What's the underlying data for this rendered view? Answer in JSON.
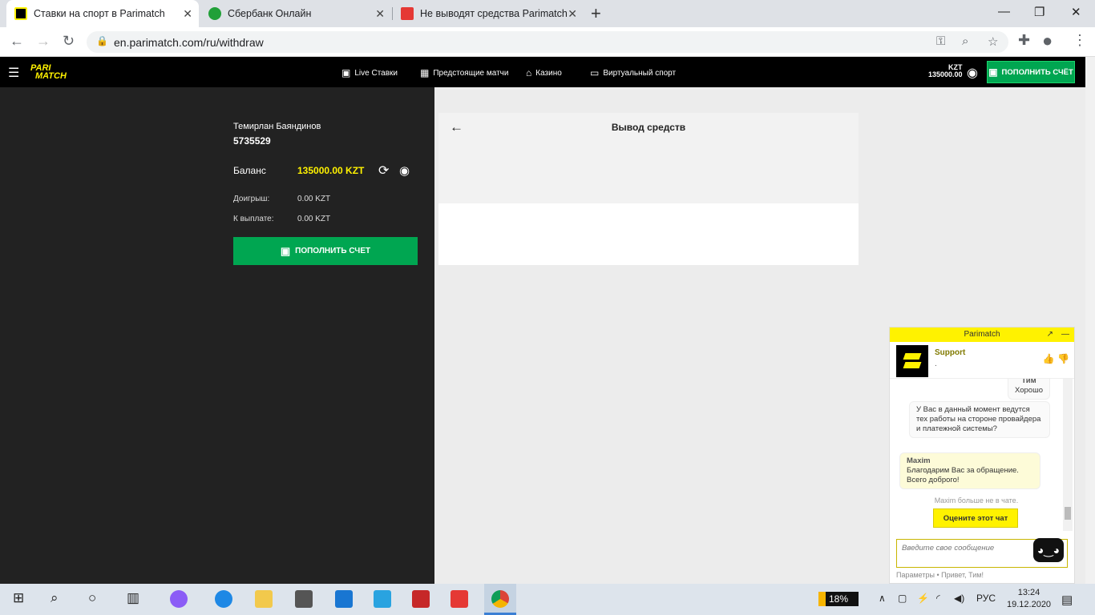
{
  "browser": {
    "tabs": [
      {
        "title": "Ставки на спорт в Parimatch",
        "active": true
      },
      {
        "title": "Сбербанк Онлайн",
        "active": false
      },
      {
        "title": "Не выводят средства Parimatch",
        "active": false
      }
    ],
    "url": "en.parimatch.com/ru/withdraw",
    "new_tab": "+",
    "close": "✕"
  },
  "header": {
    "logo_top": "PARI",
    "logo_bottom": "MATCH",
    "nav": [
      {
        "label": "Live Ставки",
        "icon": "live-icon"
      },
      {
        "label": "Предстоящие матчи",
        "icon": "calendar-icon"
      },
      {
        "label": "Казино",
        "icon": "casino-icon"
      },
      {
        "label": "Виртуальный спорт",
        "icon": "virtual-icon"
      }
    ],
    "currency": "KZT",
    "balance": "135000.00",
    "deposit_label": "ПОПОЛНИТЬ СЧЁТ"
  },
  "account": {
    "name": "Темирлан Баяндинов",
    "id": "5735529",
    "balance_label": "Баланс",
    "balance_value": "135000.00 KZT",
    "wager_label": "Доигрыш:",
    "wager_value": "0.00 KZT",
    "payout_label": "К выплате:",
    "payout_value": "0.00 KZT",
    "deposit_label": "ПОПОЛНИТЬ СЧЕТ"
  },
  "withdraw": {
    "title": "Вывод средств"
  },
  "chat": {
    "brand": "Parimatch",
    "agent": "Support",
    "agent_status": ".",
    "messages": {
      "m1_name": "Тим",
      "m1_text": "Хорошо",
      "m2_text": "У Вас в данный момент ведутся тех работы на стороне провайдера и платежной системы?",
      "m3_name": "Maxim",
      "m3_text": "Благодарим Вас за обращение. Всего доброго!"
    },
    "system": "Maxim больше не в чате.",
    "rate_label": "Оцените этот чат",
    "input_placeholder": "Введите свое сообщение",
    "footer": "Параметры • Привет, Тим!"
  },
  "taskbar": {
    "battery": "18%",
    "lang": "РУС",
    "time": "13:24",
    "date": "19.12.2020"
  },
  "colors": {
    "accent_yellow": "#fff200",
    "green": "#00a651",
    "dark": "#222222"
  }
}
